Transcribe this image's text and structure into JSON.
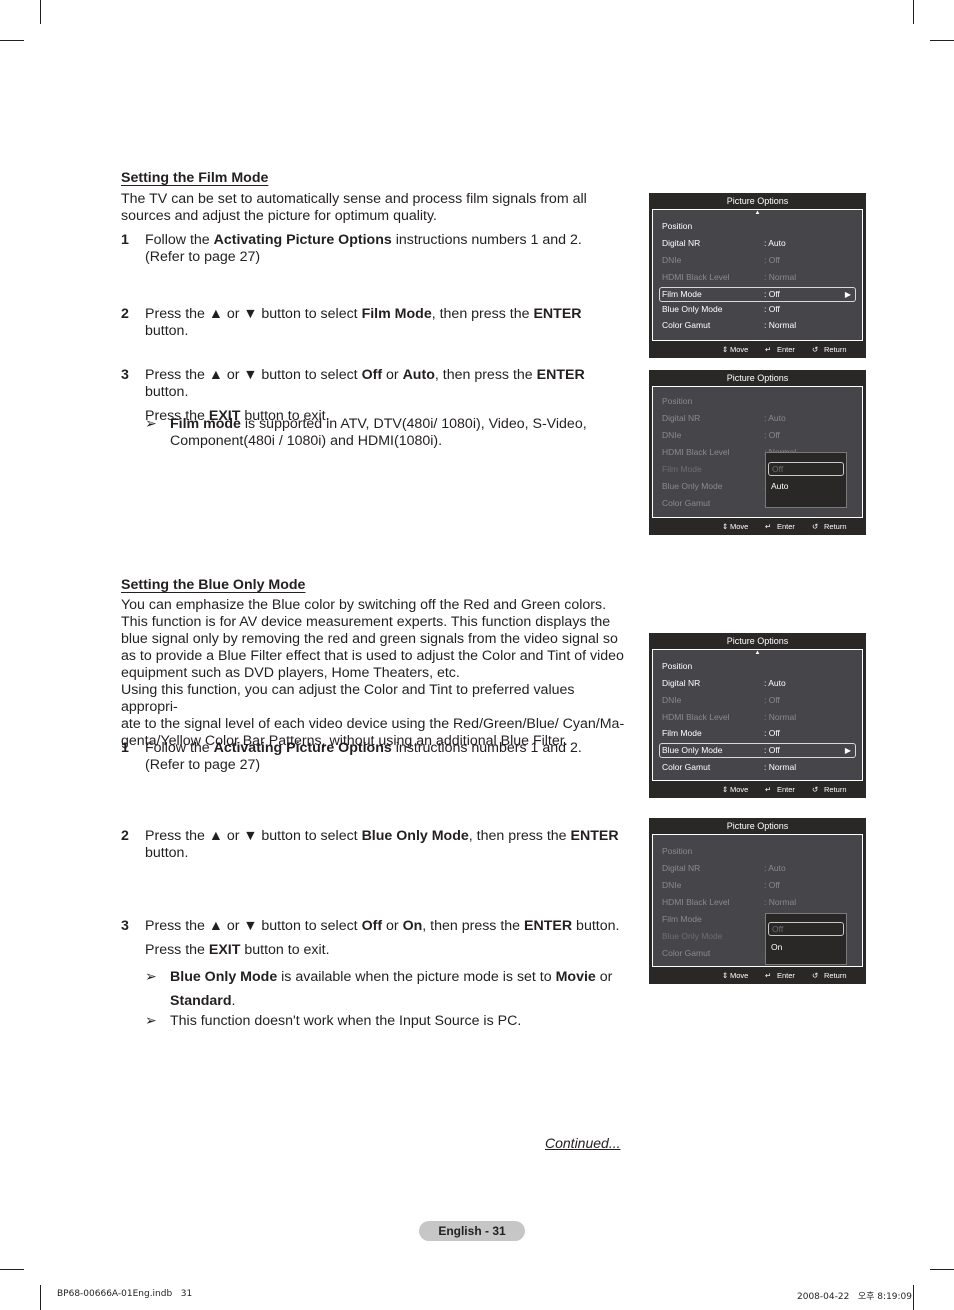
{
  "film_section": {
    "heading": "Setting the Film Mode",
    "intro_line1": "The TV can be set to automatically sense and process film signals from all",
    "intro_line2": "sources and adjust the picture for optimum quality.",
    "steps": [
      {
        "num": "1",
        "parts": [
          "Follow the ",
          "Activating Picture Options",
          " instructions numbers 1 and 2."
        ],
        "line2": "(Refer to page 27)"
      },
      {
        "num": "2",
        "parts": [
          "Press the ▲ or ▼ button to select ",
          "Film Mode",
          ", then press the ",
          "ENTER",
          " button."
        ]
      },
      {
        "num": "3",
        "parts": [
          "Press the ▲ or ▼ button to select ",
          "Off",
          " or ",
          "Auto",
          ", then press the ",
          "ENTER",
          " button."
        ],
        "line2_parts": [
          "Press the ",
          "EXIT",
          " button to exit."
        ]
      }
    ],
    "note": {
      "arrow": "➢",
      "parts": [
        "Film mode",
        " is supported in ATV, DTV(480i/ 1080i), Video, S-Video,"
      ],
      "line2": "Component(480i / 1080i) and HDMI(1080i)."
    }
  },
  "blue_section": {
    "heading": "Setting the Blue Only Mode",
    "paragraph_lines": [
      "You can emphasize the Blue color by switching off the Red and Green colors.",
      "This function is for AV device measurement experts. This function displays the",
      "blue signal only by removing the red and green signals from the video signal so",
      "as to provide a Blue Filter effect that is used to adjust the Color and Tint of video",
      "equipment such as DVD players, Home Theaters, etc.",
      "Using this function, you can adjust the Color and Tint to preferred values appropri-",
      "ate to the signal level of each video device using the Red/Green/Blue/ Cyan/Ma-",
      "genta/Yellow Color Bar Patterns, without using an additional Blue Filter."
    ],
    "steps": [
      {
        "num": "1",
        "parts": [
          "Follow the ",
          "Activating Picture Options",
          " instructions numbers 1 and 2."
        ],
        "line2": "(Refer to page 27)"
      },
      {
        "num": "2",
        "parts": [
          "Press the ▲ or ▼ button to select ",
          "Blue Only Mode",
          ", then press the ",
          "ENTER"
        ],
        "line2": "button."
      },
      {
        "num": "3",
        "parts": [
          "Press the ▲ or ▼ button to select ",
          "Off",
          " or ",
          "On",
          ", then press the ",
          "ENTER",
          " button."
        ],
        "line2_parts": [
          "Press the ",
          "EXIT",
          " button to exit."
        ]
      }
    ],
    "notes": [
      {
        "arrow": "➢",
        "parts": [
          "Blue Only Mode",
          " is available when the picture mode is set to ",
          "Movie",
          " or"
        ],
        "line2_bold": "Standard",
        "line2_tail": "."
      },
      {
        "arrow": "➢",
        "text": "This function doesn't work when the Input Source is PC."
      }
    ]
  },
  "osd": {
    "title": "Picture Options",
    "footer": {
      "move": "Move",
      "enter": "Enter",
      "return": "Return"
    },
    "rows": [
      {
        "label": "Position",
        "value": ""
      },
      {
        "label": "Digital NR",
        "value": ": Auto"
      },
      {
        "label": "DNIe",
        "value": ": Off"
      },
      {
        "label": "HDMI Black Level",
        "value": ": Normal"
      },
      {
        "label": "Film Mode",
        "value": ": Off"
      },
      {
        "label": "Blue Only Mode",
        "value": ": Off"
      },
      {
        "label": "Color Gamut",
        "value": ": Normal"
      }
    ],
    "film_popup_options": [
      "Off",
      "Auto"
    ],
    "blue_popup_options": [
      "Off",
      "On"
    ],
    "colon": ":"
  },
  "footer": {
    "continued": "Continued...",
    "page_label": "English - 31",
    "slug_left": "BP68-00666A-01Eng.indb   31",
    "slug_right": "2008-04-22   오후 8:19:09"
  }
}
